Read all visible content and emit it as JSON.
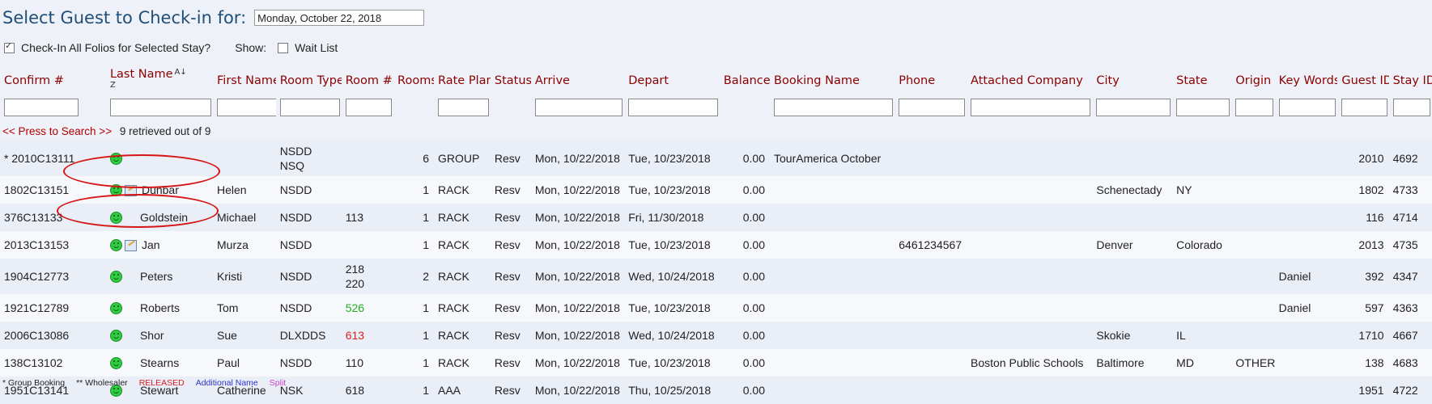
{
  "header": {
    "title": "Select Guest to Check-in for:",
    "date_value": "Monday, October 22, 2018"
  },
  "options": {
    "checkin_all_label": "Check-In All Folios for Selected Stay?",
    "checkin_all_checked": true,
    "show_label": "Show:",
    "wait_list_label": "Wait List",
    "wait_list_checked": false
  },
  "columns": [
    "Confirm #",
    "Last Name",
    "First Name",
    "Room Type",
    "Room #",
    "Rooms",
    "Rate Plan",
    "Status",
    "Arrive",
    "Depart",
    "Balance",
    "Booking Name",
    "Phone",
    "Attached Company",
    "City",
    "State",
    "Origin",
    "Key Words",
    "Guest ID",
    "Stay ID"
  ],
  "search": {
    "press_label": "<< Press to Search >>",
    "retrieved_text": "9 retrieved out of 9"
  },
  "rows": [
    {
      "confirm": "* 2010C13111",
      "icons": [
        "smiley-icon"
      ],
      "last": "",
      "first": "",
      "room_type": "NSDD\nNSQ",
      "room": "",
      "rooms": "6",
      "rate": "GROUP",
      "status": "Resv",
      "arrive": "Mon, 10/22/2018",
      "depart": "Tue, 10/23/2018",
      "balance": "0.00",
      "booking": "TourAmerica October",
      "phone": "",
      "company": "",
      "city": "",
      "state": "",
      "origin": "",
      "keywords": "",
      "guest_id": "2010",
      "stay_id": "4692"
    },
    {
      "confirm": "1802C13151",
      "icons": [
        "smiley-icon",
        "note-icon"
      ],
      "last": "Dunbar",
      "first": "Helen",
      "room_type": "NSDD",
      "room": "",
      "rooms": "1",
      "rate": "RACK",
      "status": "Resv",
      "arrive": "Mon, 10/22/2018",
      "depart": "Tue, 10/23/2018",
      "balance": "0.00",
      "booking": "",
      "phone": "",
      "company": "",
      "city": "Schenectady",
      "state": "NY",
      "origin": "",
      "keywords": "",
      "guest_id": "1802",
      "stay_id": "4733"
    },
    {
      "confirm": "376C13133",
      "icons": [
        "smiley-icon"
      ],
      "last": "Goldstein",
      "first": "Michael",
      "room_type": "NSDD",
      "room": "113",
      "rooms": "1",
      "rate": "RACK",
      "status": "Resv",
      "arrive": "Mon, 10/22/2018",
      "depart": "Fri, 11/30/2018",
      "balance": "0.00",
      "booking": "",
      "phone": "",
      "company": "",
      "city": "",
      "state": "",
      "origin": "",
      "keywords": "",
      "guest_id": "116",
      "stay_id": "4714"
    },
    {
      "confirm": "2013C13153",
      "icons": [
        "smiley-icon",
        "note-icon"
      ],
      "last": "Jan",
      "first": "Murza",
      "room_type": "NSDD",
      "room": "",
      "rooms": "1",
      "rate": "RACK",
      "status": "Resv",
      "arrive": "Mon, 10/22/2018",
      "depart": "Tue, 10/23/2018",
      "balance": "0.00",
      "booking": "",
      "phone": "6461234567",
      "company": "",
      "city": "Denver",
      "state": "Colorado",
      "origin": "",
      "keywords": "",
      "guest_id": "2013",
      "stay_id": "4735"
    },
    {
      "confirm": "1904C12773",
      "icons": [
        "smiley-icon"
      ],
      "last": "Peters",
      "first": "Kristi",
      "room_type": "NSDD",
      "room": "218\n220",
      "rooms": "2",
      "rate": "RACK",
      "status": "Resv",
      "arrive": "Mon, 10/22/2018",
      "depart": "Wed, 10/24/2018",
      "balance": "0.00",
      "booking": "",
      "phone": "",
      "company": "",
      "city": "",
      "state": "",
      "origin": "",
      "keywords": "Daniel",
      "guest_id": "392",
      "stay_id": "4347"
    },
    {
      "confirm": "1921C12789",
      "icons": [
        "smiley-icon"
      ],
      "last": "Roberts",
      "first": "Tom",
      "room_type": "NSDD",
      "room": "526",
      "room_color": "#22b022",
      "rooms": "1",
      "rate": "RACK",
      "status": "Resv",
      "arrive": "Mon, 10/22/2018",
      "depart": "Tue, 10/23/2018",
      "balance": "0.00",
      "booking": "",
      "phone": "",
      "company": "",
      "city": "",
      "state": "",
      "origin": "",
      "keywords": "Daniel",
      "guest_id": "597",
      "stay_id": "4363"
    },
    {
      "confirm": "2006C13086",
      "icons": [
        "smiley-icon"
      ],
      "last": "Shor",
      "first": "Sue",
      "room_type": "DLXDDS",
      "room": "613",
      "room_color": "#e02020",
      "rooms": "1",
      "rate": "RACK",
      "status": "Resv",
      "arrive": "Mon, 10/22/2018",
      "depart": "Wed, 10/24/2018",
      "balance": "0.00",
      "booking": "",
      "phone": "",
      "company": "",
      "city": "Skokie",
      "state": "IL",
      "origin": "",
      "keywords": "",
      "guest_id": "1710",
      "stay_id": "4667"
    },
    {
      "confirm": "138C13102",
      "icons": [
        "smiley-icon"
      ],
      "last": "Stearns",
      "first": "Paul",
      "room_type": "NSDD",
      "room": "110",
      "rooms": "1",
      "rate": "RACK",
      "status": "Resv",
      "arrive": "Mon, 10/22/2018",
      "depart": "Tue, 10/23/2018",
      "balance": "0.00",
      "booking": "",
      "phone": "",
      "company": "Boston Public Schools",
      "city": "Baltimore",
      "state": "MD",
      "origin": "OTHER",
      "keywords": "",
      "guest_id": "138",
      "stay_id": "4683"
    },
    {
      "confirm": "1951C13141",
      "icons": [
        "smiley-icon"
      ],
      "last": "Stewart",
      "first": "Catherine",
      "room_type": "NSK",
      "room": "618",
      "rooms": "1",
      "rate": "AAA",
      "status": "Resv",
      "arrive": "Mon, 10/22/2018",
      "depart": "Thu, 10/25/2018",
      "balance": "0.00",
      "booking": "",
      "phone": "",
      "company": "",
      "city": "",
      "state": "",
      "origin": "",
      "keywords": "",
      "guest_id": "1951",
      "stay_id": "4722"
    }
  ],
  "legend": {
    "group": "* Group Booking",
    "wholesaler": "** Wholesaler",
    "released": "RELEASED",
    "additional": "Additional Name",
    "split": "Split"
  },
  "colors": {
    "title": "#1f4e79",
    "header_text": "#8b0000",
    "released": "#e02020",
    "additional": "#3333cc",
    "split": "#cc44cc",
    "annotation": "#d61515"
  }
}
